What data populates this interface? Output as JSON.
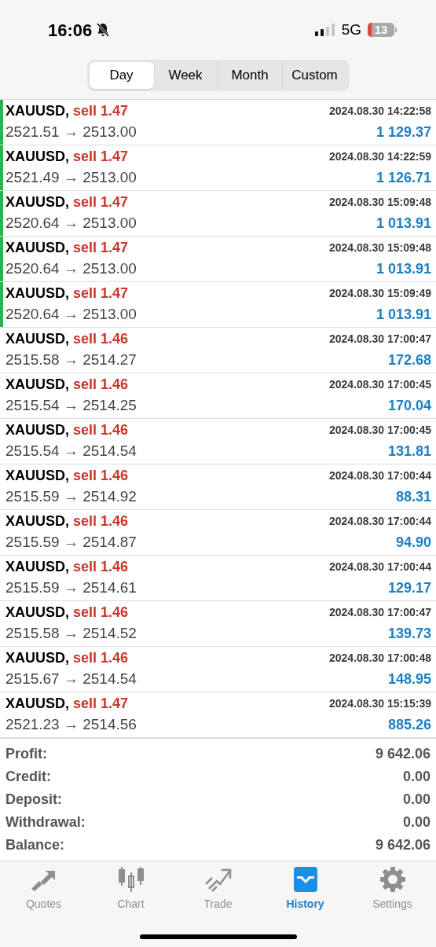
{
  "status_bar": {
    "time": "16:06",
    "network": "5G",
    "battery": "13"
  },
  "period_tabs": [
    {
      "label": "Day",
      "selected": true
    },
    {
      "label": "Week",
      "selected": false
    },
    {
      "label": "Month",
      "selected": false
    },
    {
      "label": "Custom",
      "selected": false
    }
  ],
  "deals": [
    {
      "symbol": "XAUUSD,",
      "order": "sell 1.47",
      "time": "2024.08.30 14:22:58",
      "prices": "2521.51 → 2513.00",
      "profit": "1 129.37",
      "marked": true
    },
    {
      "symbol": "XAUUSD,",
      "order": "sell 1.47",
      "time": "2024.08.30 14:22:59",
      "prices": "2521.49 → 2513.00",
      "profit": "1 126.71",
      "marked": true
    },
    {
      "symbol": "XAUUSD,",
      "order": "sell 1.47",
      "time": "2024.08.30 15:09:48",
      "prices": "2520.64 → 2513.00",
      "profit": "1 013.91",
      "marked": true
    },
    {
      "symbol": "XAUUSD,",
      "order": "sell 1.47",
      "time": "2024.08.30 15:09:48",
      "prices": "2520.64 → 2513.00",
      "profit": "1 013.91",
      "marked": true
    },
    {
      "symbol": "XAUUSD,",
      "order": "sell 1.47",
      "time": "2024.08.30 15:09:49",
      "prices": "2520.64 → 2513.00",
      "profit": "1 013.91",
      "marked": true
    },
    {
      "symbol": "XAUUSD,",
      "order": "sell 1.46",
      "time": "2024.08.30 17:00:47",
      "prices": "2515.58 → 2514.27",
      "profit": "172.68",
      "marked": false
    },
    {
      "symbol": "XAUUSD,",
      "order": "sell 1.46",
      "time": "2024.08.30 17:00:45",
      "prices": "2515.54 → 2514.25",
      "profit": "170.04",
      "marked": false
    },
    {
      "symbol": "XAUUSD,",
      "order": "sell 1.46",
      "time": "2024.08.30 17:00:45",
      "prices": "2515.54 → 2514.54",
      "profit": "131.81",
      "marked": false
    },
    {
      "symbol": "XAUUSD,",
      "order": "sell 1.46",
      "time": "2024.08.30 17:00:44",
      "prices": "2515.59 → 2514.92",
      "profit": "88.31",
      "marked": false
    },
    {
      "symbol": "XAUUSD,",
      "order": "sell 1.46",
      "time": "2024.08.30 17:00:44",
      "prices": "2515.59 → 2514.87",
      "profit": "94.90",
      "marked": false
    },
    {
      "symbol": "XAUUSD,",
      "order": "sell 1.46",
      "time": "2024.08.30 17:00:44",
      "prices": "2515.59 → 2514.61",
      "profit": "129.17",
      "marked": false
    },
    {
      "symbol": "XAUUSD,",
      "order": "sell 1.46",
      "time": "2024.08.30 17:00:47",
      "prices": "2515.58 → 2514.52",
      "profit": "139.73",
      "marked": false
    },
    {
      "symbol": "XAUUSD,",
      "order": "sell 1.46",
      "time": "2024.08.30 17:00:48",
      "prices": "2515.67 → 2514.54",
      "profit": "148.95",
      "marked": false
    },
    {
      "symbol": "XAUUSD,",
      "order": "sell 1.47",
      "time": "2024.08.30 15:15:39",
      "prices": "2521.23 → 2514.56",
      "profit": "885.26",
      "marked": false
    }
  ],
  "summary": [
    {
      "label": "Profit:",
      "value": "9 642.06"
    },
    {
      "label": "Credit:",
      "value": "0.00"
    },
    {
      "label": "Deposit:",
      "value": "0.00"
    },
    {
      "label": "Withdrawal:",
      "value": "0.00"
    },
    {
      "label": "Balance:",
      "value": "9 642.06"
    }
  ],
  "tab_bar": [
    {
      "kind": "quotes",
      "label": "Quotes",
      "selected": false
    },
    {
      "kind": "chart",
      "label": "Chart",
      "selected": false
    },
    {
      "kind": "trade",
      "label": "Trade",
      "selected": false
    },
    {
      "kind": "history",
      "label": "History",
      "selected": true
    },
    {
      "kind": "settings",
      "label": "Settings",
      "selected": false
    }
  ]
}
